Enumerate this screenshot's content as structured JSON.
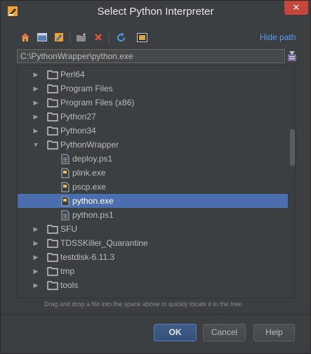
{
  "window": {
    "title": "Select Python Interpreter",
    "close_glyph": "✕"
  },
  "toolbar": {
    "icons": [
      "home-icon",
      "desktop-icon",
      "project-icon",
      "new-folder-icon",
      "delete-icon",
      "refresh-icon",
      "show-hidden-icon"
    ],
    "hide_path_label": "Hide path"
  },
  "path": {
    "value": "C:\\PythonWrapper\\python.exe"
  },
  "tree": {
    "rows": [
      {
        "label": "Perl64",
        "type": "folder",
        "expanded": false,
        "selected": false
      },
      {
        "label": "Program Files",
        "type": "folder",
        "expanded": false,
        "selected": false
      },
      {
        "label": "Program Files (x86)",
        "type": "folder",
        "expanded": false,
        "selected": false
      },
      {
        "label": "Python27",
        "type": "folder",
        "expanded": false,
        "selected": false
      },
      {
        "label": "Python34",
        "type": "folder",
        "expanded": false,
        "selected": false
      },
      {
        "label": "PythonWrapper",
        "type": "folder",
        "expanded": true,
        "selected": false
      },
      {
        "label": "deploy.ps1",
        "type": "file",
        "selected": false
      },
      {
        "label": "plink.exe",
        "type": "file",
        "selected": false
      },
      {
        "label": "pscp.exe",
        "type": "file",
        "selected": false
      },
      {
        "label": "python.exe",
        "type": "file",
        "selected": true
      },
      {
        "label": "python.ps1",
        "type": "file",
        "selected": false
      },
      {
        "label": "SFU",
        "type": "folder",
        "expanded": false,
        "selected": false
      },
      {
        "label": "TDSSKiller_Quarantine",
        "type": "folder",
        "expanded": false,
        "selected": false
      },
      {
        "label": "testdisk-6.11.3",
        "type": "folder",
        "expanded": false,
        "selected": false
      },
      {
        "label": "tmp",
        "type": "folder",
        "expanded": false,
        "selected": false
      },
      {
        "label": "tools",
        "type": "folder",
        "expanded": false,
        "selected": false
      }
    ]
  },
  "hint": "Drag and drop a file into the space above to quickly locate it in the tree.",
  "buttons": {
    "ok": "OK",
    "cancel": "Cancel",
    "help": "Help"
  },
  "colors": {
    "selection": "#4b6eaf",
    "link": "#589df6",
    "close": "#c7453a"
  }
}
